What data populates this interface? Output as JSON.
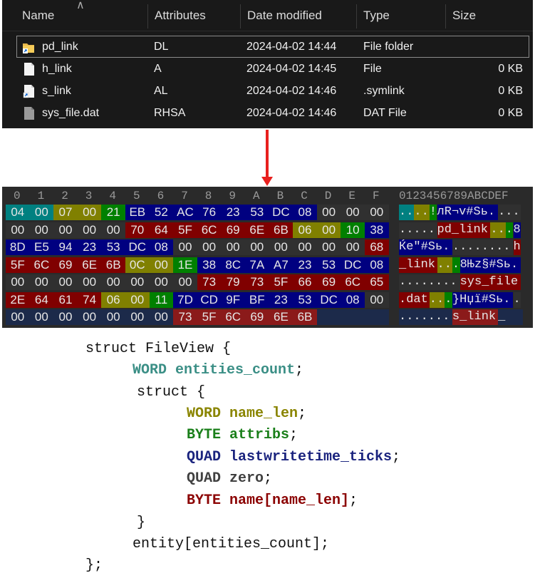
{
  "explorer": {
    "columns": [
      "Name",
      "Attributes",
      "Date modified",
      "Type",
      "Size"
    ],
    "rows": [
      {
        "name": "pd_link",
        "attributes": "DL",
        "date": "2024-04-02 14:44",
        "type": "File folder",
        "size": "",
        "icon": "folder-link-icon"
      },
      {
        "name": "h_link",
        "attributes": "A",
        "date": "2024-04-02 14:45",
        "type": "File",
        "size": "0 KB",
        "icon": "file-icon"
      },
      {
        "name": "s_link",
        "attributes": "AL",
        "date": "2024-04-02 14:46",
        "type": ".symlink",
        "size": "0 KB",
        "icon": "file-link-icon"
      },
      {
        "name": "sys_file.dat",
        "attributes": "RHSA",
        "date": "2024-04-02 14:46",
        "type": "DAT File",
        "size": "0 KB",
        "icon": "system-file-icon"
      }
    ]
  },
  "hex": {
    "header_hex": [
      "0",
      "1",
      "2",
      "3",
      "4",
      "5",
      "6",
      "7",
      "8",
      "9",
      "A",
      "B",
      "C",
      "D",
      "E",
      "F"
    ],
    "header_ascii": "0123456789ABCDEF",
    "rows": [
      {
        "bytes": [
          [
            "04",
            "teal"
          ],
          [
            "00",
            "teal"
          ],
          [
            "07",
            "olive"
          ],
          [
            "00",
            "olive"
          ],
          [
            "21",
            "green"
          ],
          [
            "EB",
            "navy"
          ],
          [
            "52",
            "navy"
          ],
          [
            "AC",
            "navy"
          ],
          [
            "76",
            "navy"
          ],
          [
            "23",
            "navy"
          ],
          [
            "53",
            "navy"
          ],
          [
            "DC",
            "navy"
          ],
          [
            "08",
            "navy"
          ],
          [
            "00",
            "gray"
          ],
          [
            "00",
            "gray"
          ],
          [
            "00",
            "gray"
          ]
        ],
        "ascii": [
          [
            "..",
            "teal"
          ],
          [
            "..",
            "olive"
          ],
          [
            "!",
            "green"
          ],
          [
            "лR¬v#Sь.",
            "navy"
          ],
          [
            "...",
            "gray"
          ]
        ]
      },
      {
        "bytes": [
          [
            "00",
            "gray"
          ],
          [
            "00",
            "gray"
          ],
          [
            "00",
            "gray"
          ],
          [
            "00",
            "gray"
          ],
          [
            "00",
            "gray"
          ],
          [
            "70",
            "maroon"
          ],
          [
            "64",
            "maroon"
          ],
          [
            "5F",
            "maroon"
          ],
          [
            "6C",
            "maroon"
          ],
          [
            "69",
            "maroon"
          ],
          [
            "6E",
            "maroon"
          ],
          [
            "6B",
            "maroon"
          ],
          [
            "06",
            "olive"
          ],
          [
            "00",
            "olive"
          ],
          [
            "10",
            "green"
          ],
          [
            "38",
            "navy"
          ]
        ],
        "ascii": [
          [
            ".....",
            "gray"
          ],
          [
            "pd_link",
            "maroon"
          ],
          [
            "..",
            "olive"
          ],
          [
            ".",
            "green"
          ],
          [
            "8",
            "navy"
          ]
        ]
      },
      {
        "bytes": [
          [
            "8D",
            "navy"
          ],
          [
            "E5",
            "navy"
          ],
          [
            "94",
            "navy"
          ],
          [
            "23",
            "navy"
          ],
          [
            "53",
            "navy"
          ],
          [
            "DC",
            "navy"
          ],
          [
            "08",
            "navy"
          ],
          [
            "00",
            "gray"
          ],
          [
            "00",
            "gray"
          ],
          [
            "00",
            "gray"
          ],
          [
            "00",
            "gray"
          ],
          [
            "00",
            "gray"
          ],
          [
            "00",
            "gray"
          ],
          [
            "00",
            "gray"
          ],
          [
            "00",
            "gray"
          ],
          [
            "68",
            "maroon"
          ]
        ],
        "ascii": [
          [
            "Ќе\"#Sь.",
            "navy"
          ],
          [
            "........",
            "gray"
          ],
          [
            "h",
            "maroon"
          ]
        ]
      },
      {
        "bytes": [
          [
            "5F",
            "maroon"
          ],
          [
            "6C",
            "maroon"
          ],
          [
            "69",
            "maroon"
          ],
          [
            "6E",
            "maroon"
          ],
          [
            "6B",
            "maroon"
          ],
          [
            "0C",
            "olive"
          ],
          [
            "00",
            "olive"
          ],
          [
            "1E",
            "green"
          ],
          [
            "38",
            "navy"
          ],
          [
            "8C",
            "navy"
          ],
          [
            "7A",
            "navy"
          ],
          [
            "A7",
            "navy"
          ],
          [
            "23",
            "navy"
          ],
          [
            "53",
            "navy"
          ],
          [
            "DC",
            "navy"
          ],
          [
            "08",
            "navy"
          ]
        ],
        "ascii": [
          [
            "_link",
            "maroon"
          ],
          [
            "..",
            "olive"
          ],
          [
            ".",
            "green"
          ],
          [
            "8Њz§#Sь.",
            "navy"
          ]
        ]
      },
      {
        "bytes": [
          [
            "00",
            "gray"
          ],
          [
            "00",
            "gray"
          ],
          [
            "00",
            "gray"
          ],
          [
            "00",
            "gray"
          ],
          [
            "00",
            "gray"
          ],
          [
            "00",
            "gray"
          ],
          [
            "00",
            "gray"
          ],
          [
            "00",
            "gray"
          ],
          [
            "73",
            "maroon"
          ],
          [
            "79",
            "maroon"
          ],
          [
            "73",
            "maroon"
          ],
          [
            "5F",
            "maroon"
          ],
          [
            "66",
            "maroon"
          ],
          [
            "69",
            "maroon"
          ],
          [
            "6C",
            "maroon"
          ],
          [
            "65",
            "maroon"
          ]
        ],
        "ascii": [
          [
            "........",
            "gray"
          ],
          [
            "sys_file",
            "maroon"
          ]
        ]
      },
      {
        "bytes": [
          [
            "2E",
            "maroon"
          ],
          [
            "64",
            "maroon"
          ],
          [
            "61",
            "maroon"
          ],
          [
            "74",
            "maroon"
          ],
          [
            "06",
            "olive"
          ],
          [
            "00",
            "olive"
          ],
          [
            "11",
            "green"
          ],
          [
            "7D",
            "navy"
          ],
          [
            "CD",
            "navy"
          ],
          [
            "9F",
            "navy"
          ],
          [
            "BF",
            "navy"
          ],
          [
            "23",
            "navy"
          ],
          [
            "53",
            "navy"
          ],
          [
            "DC",
            "navy"
          ],
          [
            "08",
            "navy"
          ],
          [
            "00",
            "gray"
          ]
        ],
        "ascii": [
          [
            ".dat",
            "maroon"
          ],
          [
            "..",
            "olive"
          ],
          [
            ".",
            "green"
          ],
          [
            "}Нџї#Sь.",
            "navy"
          ],
          [
            ".",
            "gray"
          ]
        ]
      },
      {
        "bytes": [
          [
            "00",
            "slate"
          ],
          [
            "00",
            "slate"
          ],
          [
            "00",
            "slate"
          ],
          [
            "00",
            "slate"
          ],
          [
            "00",
            "slate"
          ],
          [
            "00",
            "slate"
          ],
          [
            "00",
            "slate"
          ],
          [
            "73",
            "red"
          ],
          [
            "5F",
            "red"
          ],
          [
            "6C",
            "red"
          ],
          [
            "69",
            "red"
          ],
          [
            "6E",
            "red"
          ],
          [
            "6B",
            "red"
          ]
        ],
        "ascii": [
          [
            ".......",
            "slate"
          ],
          [
            "s_link",
            "red"
          ],
          [
            "_",
            "slate"
          ]
        ]
      }
    ]
  },
  "code": {
    "lines": [
      [
        [
          "struct FileView {",
          "plain"
        ]
      ],
      [
        [
          "WORD entities_count",
          "teal"
        ],
        [
          ";",
          "plain"
        ]
      ],
      [
        [
          "struct {",
          "plain"
        ]
      ],
      [
        [
          "WORD name_len",
          "olive"
        ],
        [
          ";",
          "plain"
        ]
      ],
      [
        [
          "BYTE attribs",
          "green"
        ],
        [
          ";",
          "plain"
        ]
      ],
      [
        [
          "QUAD lastwritetime_ticks",
          "navy"
        ],
        [
          ";",
          "plain"
        ]
      ],
      [
        [
          "QUAD zero",
          "gray"
        ],
        [
          ";",
          "plain"
        ]
      ],
      [
        [
          "BYTE name[name_len]",
          "maroon"
        ],
        [
          ";",
          "plain"
        ]
      ],
      [
        [
          "}",
          "plain"
        ]
      ],
      [
        [
          "entity[entities_count];",
          "plain"
        ]
      ],
      [
        [
          "};",
          "plain"
        ]
      ]
    ]
  },
  "colors": {
    "teal": "#008080",
    "olive": "#808000",
    "green": "#008000",
    "navy": "#000080",
    "maroon": "#800000",
    "arrow": "#e8201e"
  }
}
